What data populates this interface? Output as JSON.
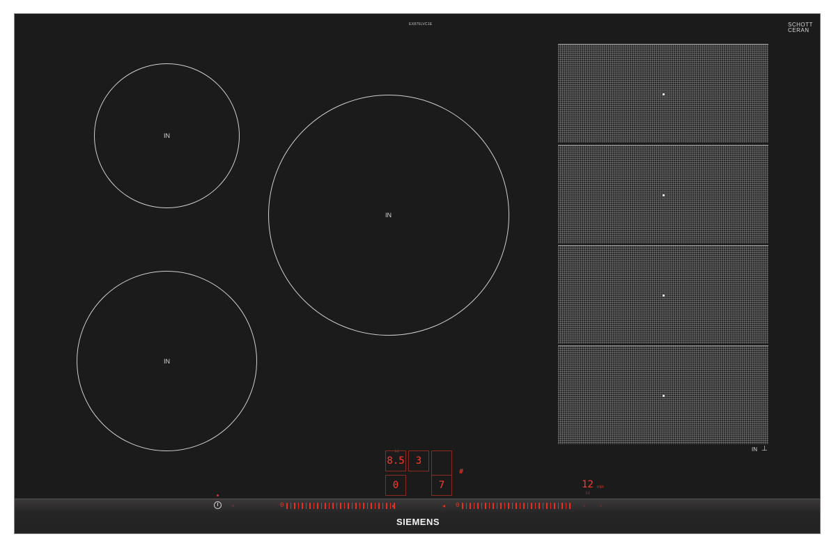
{
  "hob": {
    "model_text": "EX875LVC1E",
    "logo_line1": "SCHOTT",
    "logo_line2": "CERAN",
    "logo_small": "",
    "brand": "SIEMENS"
  },
  "zones": [
    {
      "label": "IN"
    },
    {
      "label": "IN"
    },
    {
      "label": "IN"
    }
  ],
  "flex_zone": {
    "label": "IN",
    "icon": "flex-induction-icon",
    "segments": 4
  },
  "display": {
    "top_left_value": "8.5",
    "top_left_indicator": "I-I",
    "top_mid_value": "3",
    "bottom_left_value": "0",
    "bottom_right_value": "7",
    "timer_value": "12",
    "timer_unit": "min",
    "timer_icon_label": "I-I",
    "hash": "#"
  },
  "controls": {
    "slider_left_start": "0",
    "slider_right_start": "0",
    "slider_tick_count": 29,
    "power_icon": "power-icon"
  },
  "colors": {
    "glass": "#1c1b1b",
    "display_red": "#ff3b2b",
    "zone_line": "#d0d0d0"
  }
}
